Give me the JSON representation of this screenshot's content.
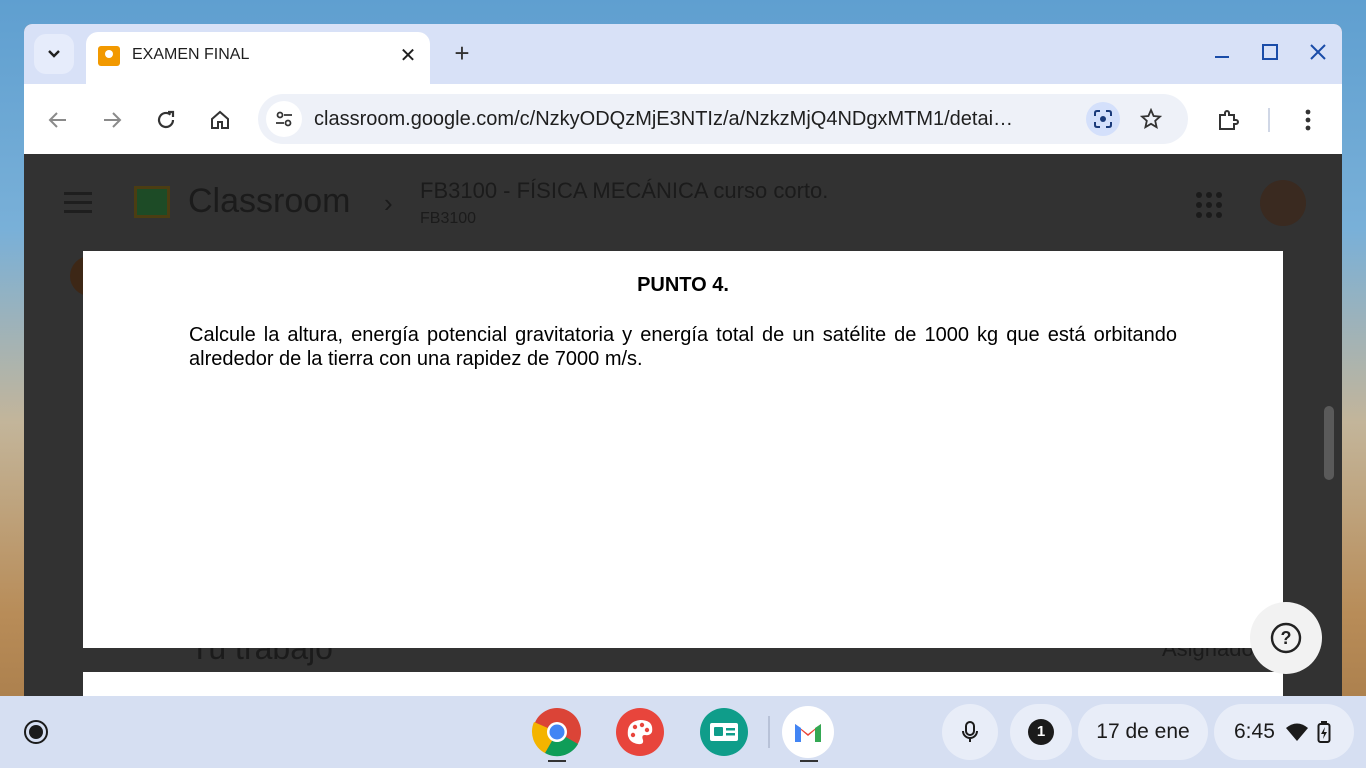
{
  "browser": {
    "tab": {
      "title": "EXAMEN FINAL",
      "close": "✕"
    },
    "new_tab": "+",
    "window_controls": {
      "minimize": "—",
      "maximize": "▢",
      "close": "✕"
    },
    "url": "classroom.google.com/c/NzkyODQzMjE3NTIz/a/NzkzMjQ4NDgxMTM1/details…"
  },
  "classroom": {
    "app_name": "Classroom",
    "breadcrumb_sep": "›",
    "course_title": "FB3100 - FÍSICA MECÁNICA curso corto.",
    "course_code": "FB3100",
    "section_title": "Tu trabajo",
    "status": "Asignado"
  },
  "document": {
    "heading": "PUNTO 4.",
    "body": "Calcule la altura, energía potencial gravitatoria y energía total de un satélite de 1000 kg que está orbitando alrededor de la tierra con una rapidez de 7000 m/s."
  },
  "help": {
    "label": "?"
  },
  "shelf": {
    "apps": [
      "chrome-icon",
      "paint-icon",
      "classroom-app-icon",
      "gmail-icon"
    ],
    "notification_count": "1",
    "date": "17 de ene",
    "time": "6:45"
  }
}
